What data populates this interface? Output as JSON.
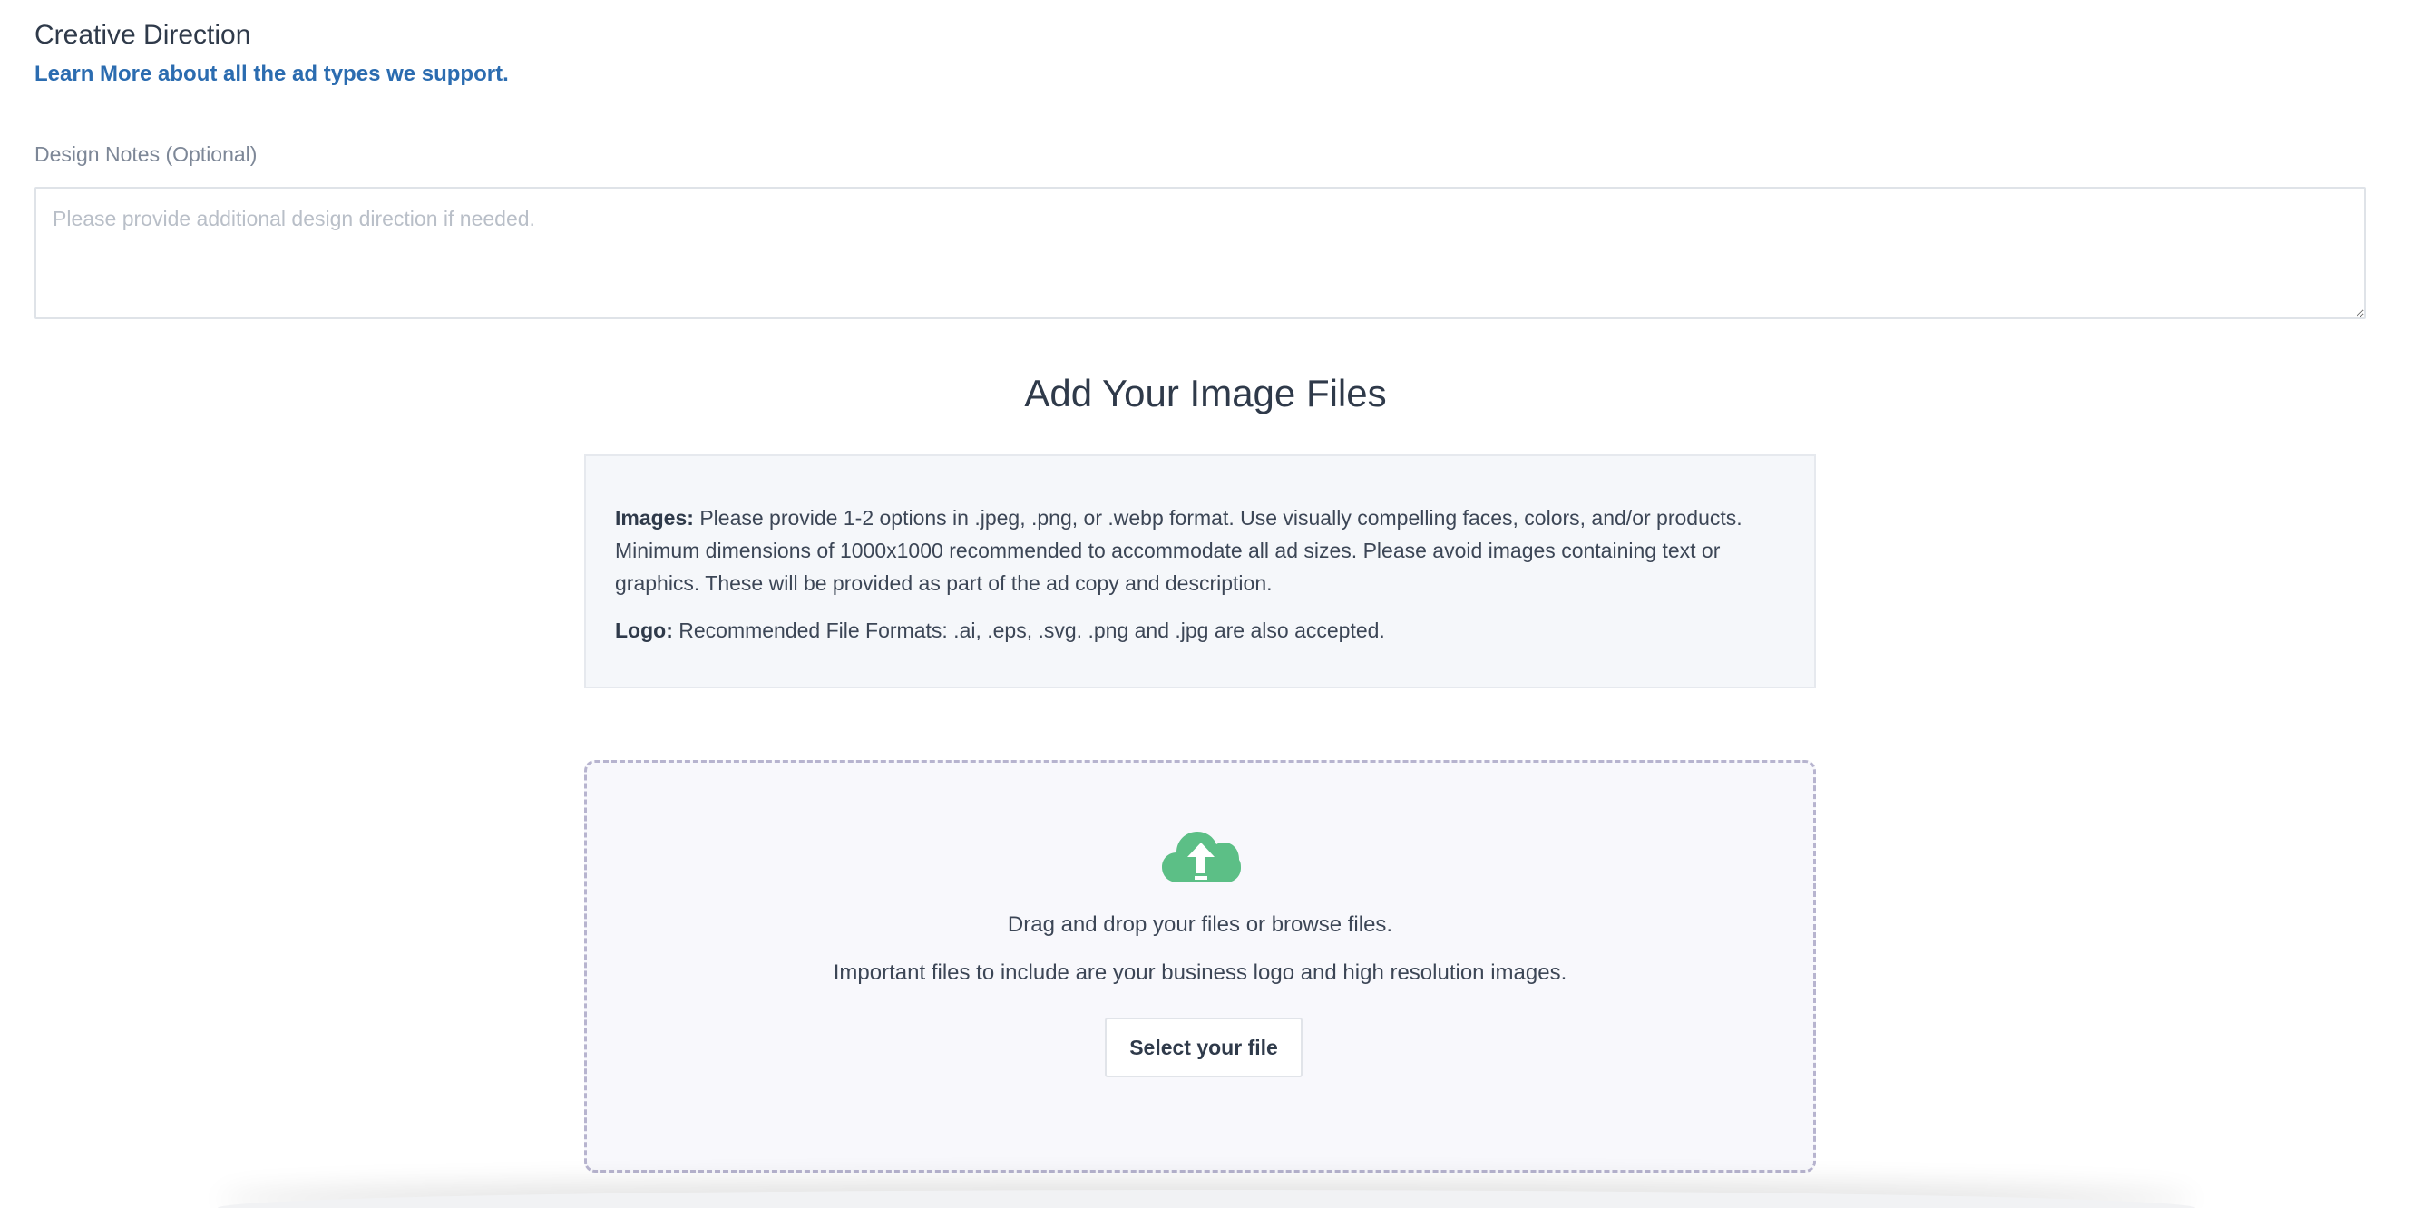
{
  "section": {
    "title": "Creative Direction",
    "learn_link": "Learn More about all the ad types we support."
  },
  "design_notes": {
    "label": "Design Notes (Optional)",
    "placeholder": "Please provide additional design direction if needed.",
    "value": ""
  },
  "upload": {
    "heading": "Add Your Image Files",
    "info": {
      "images_label": "Images:",
      "images_text": " Please provide 1-2 options in .jpeg, .png, or .webp format. Use visually compelling faces, colors, and/or products. Minimum dimensions of 1000x1000 recommended to accommodate all ad sizes. Please avoid images containing text or graphics. These will be provided as part of the ad copy and description.",
      "logo_label": "Logo:",
      "logo_text": " Recommended File Formats: .ai, .eps, .svg. .png and .jpg are also accepted."
    },
    "dropzone": {
      "icon": "cloud-upload-icon",
      "line1": "Drag and drop your files or browse files.",
      "line2": "Important files to include are your business logo and high resolution images.",
      "button_label": "Select your file"
    }
  },
  "colors": {
    "link": "#2b6cb0",
    "upload_icon": "#5cbf86",
    "dropzone_border": "#b7b4cf",
    "info_bg": "#f5f7fa"
  }
}
